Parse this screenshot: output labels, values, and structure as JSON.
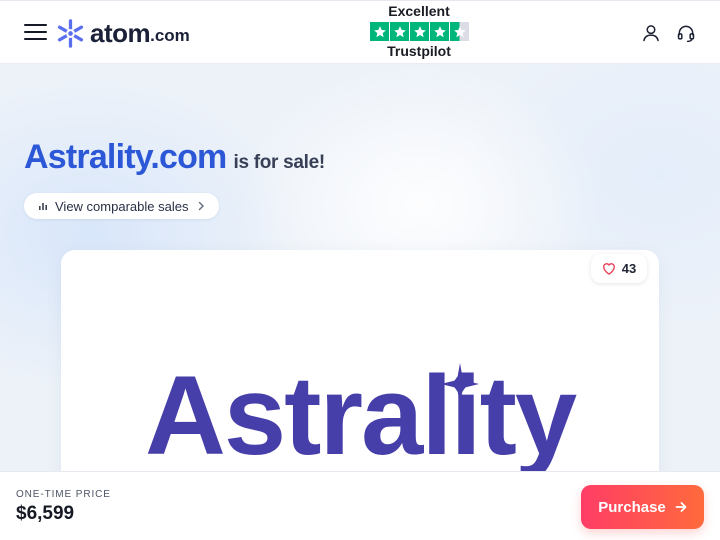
{
  "header": {
    "logo": {
      "name": "atom",
      "tld": ".com"
    },
    "trustpilot": {
      "rating_text": "Excellent",
      "brand": "Trustpilot",
      "stars": 4.5
    },
    "icons": [
      "menu-icon",
      "user-icon",
      "headset-icon"
    ]
  },
  "hero": {
    "domain": "Astrality.com",
    "suffix": "is for sale!",
    "comparable_label": "View comparable sales",
    "likes": "43",
    "brand_wordmark": "Astrality"
  },
  "footer": {
    "price_label": "ONE-TIME PRICE",
    "price": "$6,599",
    "purchase_label": "Purchase"
  },
  "colors": {
    "accent_blue": "#2c57d6",
    "brand_purple": "#463ea9",
    "trustpilot_green": "#00b67a",
    "cta_start": "#ff3d66",
    "cta_end": "#ff6a3c"
  }
}
